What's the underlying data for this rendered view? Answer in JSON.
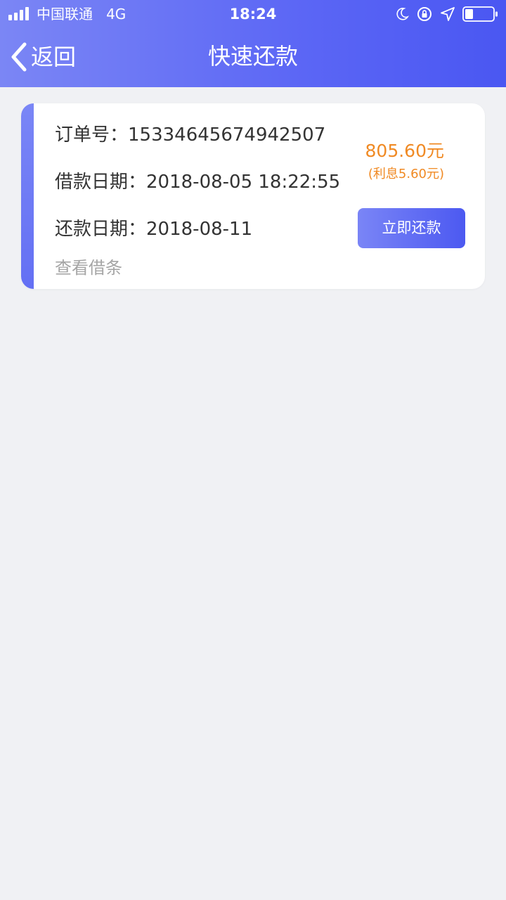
{
  "status_bar": {
    "carrier": "中国联通",
    "network": "4G",
    "time": "18:24",
    "icons": [
      "signal-icon",
      "moon-icon",
      "orientation-lock-icon",
      "location-arrow-icon",
      "battery-icon"
    ]
  },
  "nav": {
    "back_label": "返回",
    "title": "快速还款"
  },
  "loan_card": {
    "order_label": "订单号：",
    "order_value": "15334645674942507",
    "loan_date_label": "借款日期：",
    "loan_date_value": "2018-08-05 18:22:55",
    "repay_date_label": "还款日期：",
    "repay_date_value": "2018-08-11",
    "view_note_label": "查看借条",
    "amount": "805.60元",
    "interest": "(利息5.60元)",
    "repay_button_label": "立即还款"
  },
  "colors": {
    "header_gradient_start": "#7b86f5",
    "header_gradient_end": "#4a57f2",
    "accent_orange": "#f08a24",
    "background": "#f0f1f4"
  }
}
